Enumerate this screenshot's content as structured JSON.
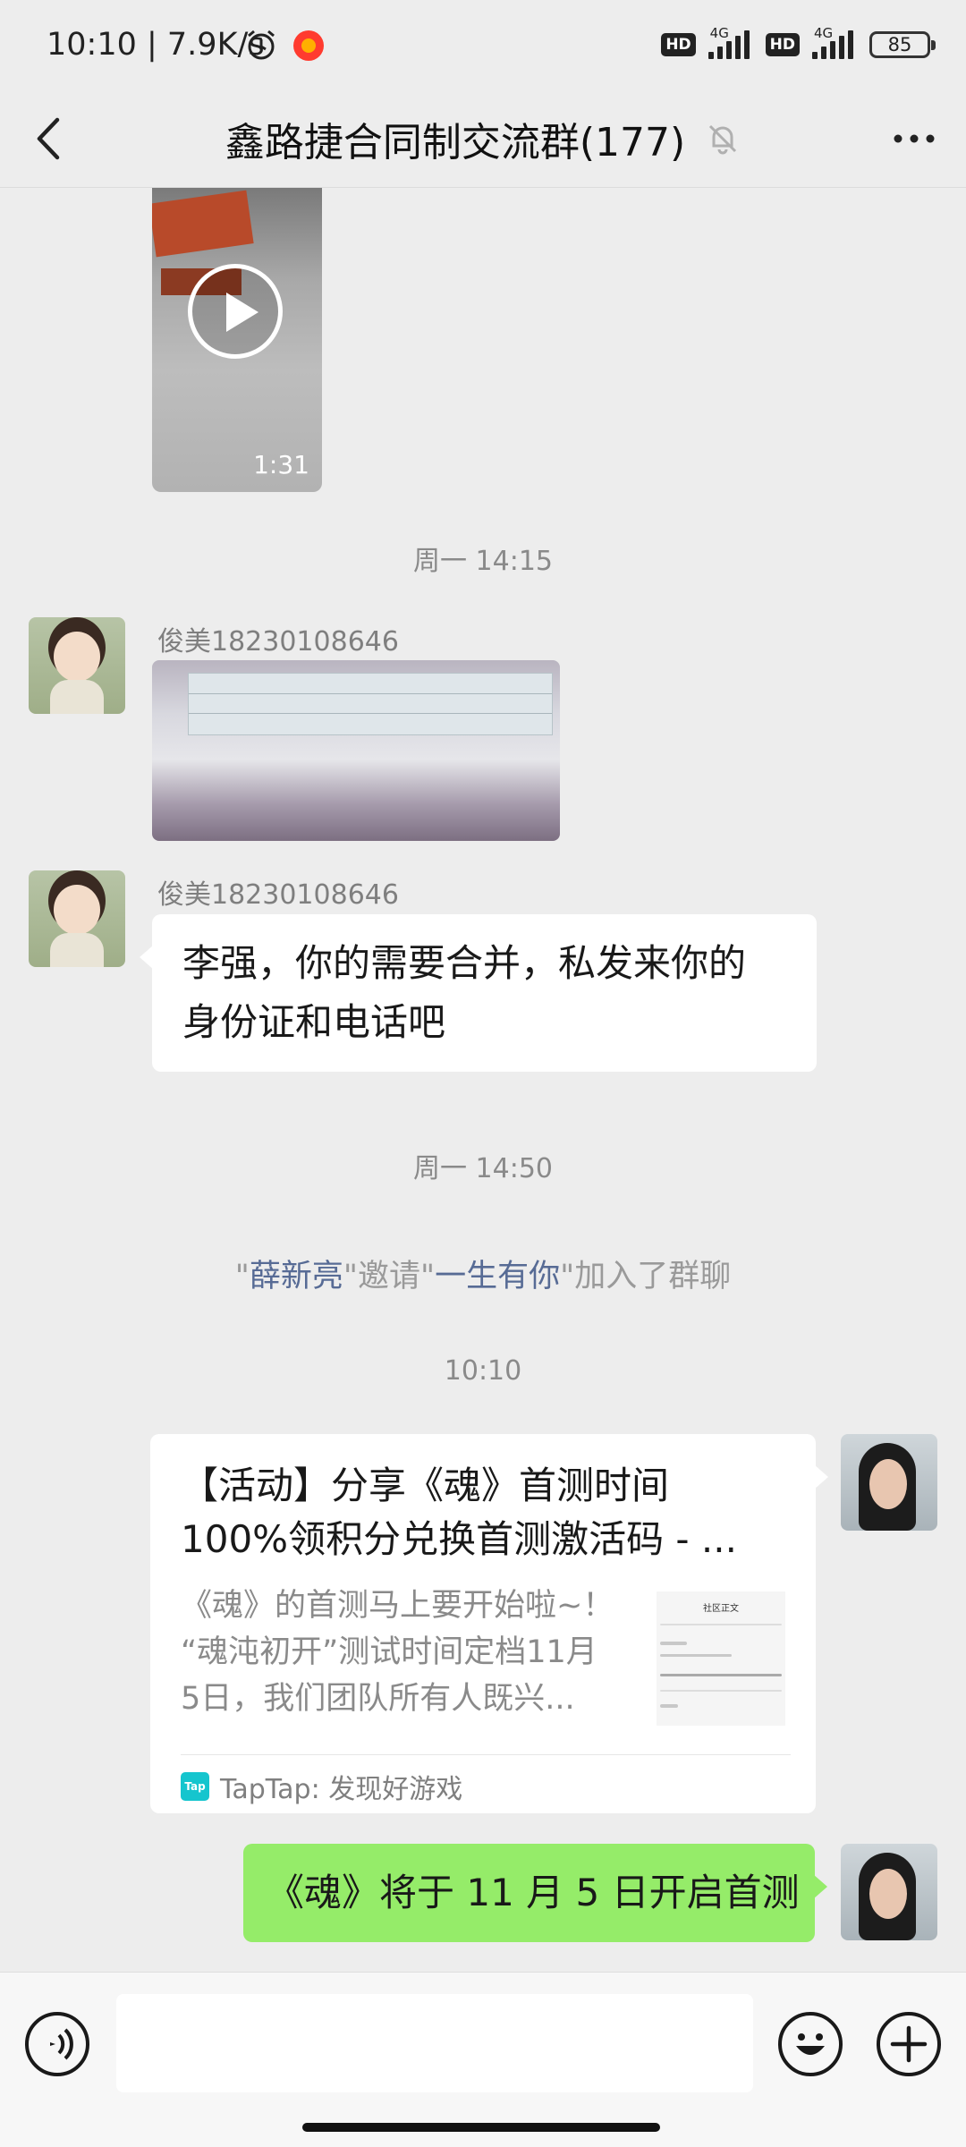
{
  "status_bar": {
    "time_speed": "10:10 | 7.9K/s",
    "hd1": "HD",
    "net1": "4G",
    "hd2": "HD",
    "net2": "4G",
    "battery": "85"
  },
  "header": {
    "title": "鑫路捷合同制交流群(177)"
  },
  "messages": {
    "video_duration": "1:31",
    "time1": "周一 14:15",
    "sender1": "俊美18230108646",
    "sender2": "俊美18230108646",
    "text1_line1": "李强，你的需要合并，私发来你的",
    "text1_line2": "身份证和电话吧",
    "time2": "周一 14:50",
    "system": {
      "q1": "\"",
      "inviter": "薛新亮",
      "q2": "\"",
      "invite_word": "邀请",
      "q3": "\"",
      "invitee": "一生有你",
      "q4": "\"",
      "suffix": "加入了群聊"
    },
    "time3": "10:10",
    "card": {
      "title_line1": "【活动】分享《魂》首测时间",
      "title_line2": "100%领积分兑换首测激活码 - ...",
      "desc_line1": "《魂》的首测马上要开始啦~！",
      "desc_line2": "“魂沌初开”测试时间定档11月",
      "desc_line3": "5日，我们团队所有人既兴...",
      "thumb_title": "社区正文",
      "source_icon": "Tap",
      "source": "TapTap: 发现好游戏"
    },
    "text2": "《魂》将于 11 月 5 日开启首测"
  },
  "input": {
    "placeholder": ""
  },
  "colors": {
    "background": "#ededed",
    "sent_bubble": "#95ec69",
    "link_name": "#576b95"
  }
}
